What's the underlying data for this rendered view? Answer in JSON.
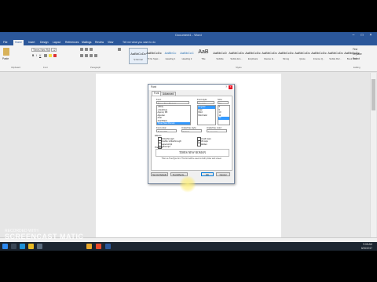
{
  "window": {
    "title": "Document1 - Word"
  },
  "tabs": [
    "File",
    "Home",
    "Insert",
    "Design",
    "Layout",
    "References",
    "Mailings",
    "Review",
    "View"
  ],
  "tell_me": "Tell me what you want to do",
  "ribbon": {
    "font_name": "Times New Ro",
    "font_size": "12",
    "styles": [
      {
        "sample": "AaBbCcDc",
        "name": "¶ Normal"
      },
      {
        "sample": "AaBbCcDc",
        "name": "¶ No Spac..."
      },
      {
        "sample": "AaBbCc",
        "name": "Heading 1"
      },
      {
        "sample": "AaBbCcC",
        "name": "Heading 2"
      },
      {
        "sample": "AaB",
        "name": "Title"
      },
      {
        "sample": "AaBbCcD",
        "name": "Subtitle"
      },
      {
        "sample": "AaBbCcDc",
        "name": "Subtle Em..."
      },
      {
        "sample": "AaBbCcDc",
        "name": "Emphasis"
      },
      {
        "sample": "AaBbCcDc",
        "name": "Intense E..."
      },
      {
        "sample": "AaBbCcDc",
        "name": "Strong"
      },
      {
        "sample": "AaBbCcDc",
        "name": "Quote"
      },
      {
        "sample": "AaBbCcDc",
        "name": "Intense Q..."
      },
      {
        "sample": "AaBbCcDc",
        "name": "Subtle Ref..."
      },
      {
        "sample": "AaBbCcDc",
        "name": "Book Title"
      }
    ],
    "editing": [
      "Find",
      "Replace",
      "Select"
    ]
  },
  "dialog": {
    "title": "Font",
    "tabs": [
      "Font",
      "Advanced"
    ],
    "font_label": "Font:",
    "font_value": "Times New Roman",
    "font_list": [
      "+Body",
      "+Headings",
      "Agency FB",
      "Algerian",
      "Arial",
      "Arial Black",
      "Times New Roman"
    ],
    "style_label": "Font style:",
    "style_value": "Regular",
    "style_list": [
      "Regular",
      "Italic",
      "Bold",
      "Bold Italic"
    ],
    "size_label": "Size:",
    "size_value": "12",
    "size_list": [
      "8",
      "9",
      "10",
      "11",
      "12"
    ],
    "color_label": "Font color:",
    "color_value": "Automatic",
    "underline_label": "Underline style:",
    "underline_value": "(none)",
    "ucolor_label": "Underline color:",
    "ucolor_value": "Automatic",
    "effects_label": "Effects",
    "effects_left": [
      "Strikethrough",
      "Double strikethrough",
      "Superscript",
      "Subscript"
    ],
    "effects_right": [
      "Small caps",
      "All caps",
      "Hidden"
    ],
    "effects_checked_right": [
      false,
      true,
      false
    ],
    "preview_label": "Preview",
    "preview_text": "TIMES NEW ROMAN",
    "hint": "This is a TrueType font. This font will be used on both printer and screen.",
    "buttons": [
      "Set As Default",
      "Text Effects...",
      "OK",
      "Cancel"
    ]
  },
  "taskbar": {
    "time": "9:08 AM",
    "date": "8/26/2017"
  },
  "watermark": {
    "line1": "RECORDED WITH",
    "line2": "SCREENCAST",
    "line3": "MATIC"
  }
}
